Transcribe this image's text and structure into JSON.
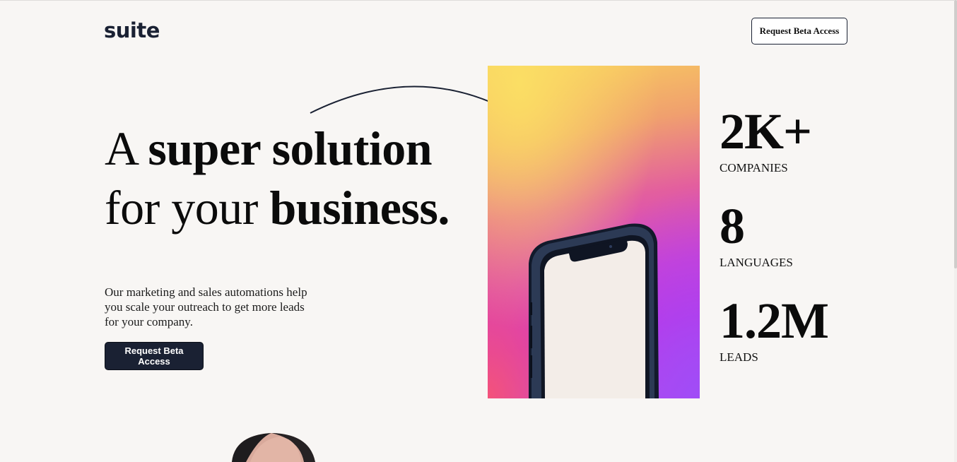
{
  "header": {
    "logo": "suite",
    "cta_label": "Request Beta Access"
  },
  "hero": {
    "headline": {
      "line1_regular": "A ",
      "line1_bold": "super solution",
      "line2_regular": "for your ",
      "line2_bold": "business."
    },
    "subcopy": "Our marketing and sales automations help you scale your outreach to get more leads for your company.",
    "cta_label": "Request Beta Access"
  },
  "stats": [
    {
      "value": "2K+",
      "label": "COMPANIES"
    },
    {
      "value": "8",
      "label": "LANGUAGES"
    },
    {
      "value": "1.2M",
      "label": "LEADS"
    }
  ],
  "colors": {
    "brand_dark": "#1a2133",
    "background": "#f8f6f4",
    "gradient": [
      "#fbde64",
      "#e35f9e",
      "#c52fe0",
      "#a04cf7"
    ]
  }
}
